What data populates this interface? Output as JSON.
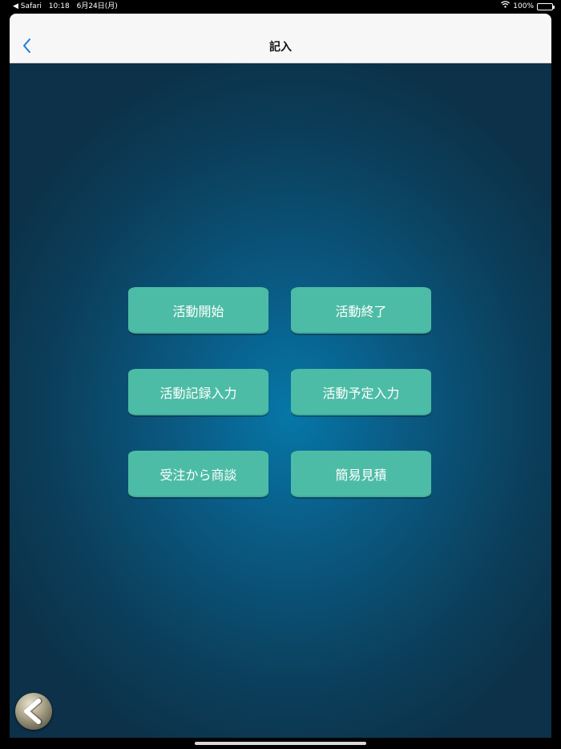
{
  "status_bar": {
    "back_app": "◀ Safari",
    "time": "10:18",
    "date": "6月24日(月)",
    "battery": "100%"
  },
  "nav": {
    "title": "記入"
  },
  "buttons": [
    {
      "label": "活動開始"
    },
    {
      "label": "活動終了"
    },
    {
      "label": "活動記録入力"
    },
    {
      "label": "活動予定入力"
    },
    {
      "label": "受注から商談"
    },
    {
      "label": "簡易見積"
    }
  ],
  "colors": {
    "button": "#4dbca6",
    "accent": "#1a7ae0",
    "background_center": "#0677a8",
    "background_edge": "#0c3149"
  },
  "icons": {
    "nav_back": "chevron-left-icon",
    "round_back": "round-back-arrow-icon",
    "wifi": "wifi-icon",
    "battery": "battery-icon"
  }
}
